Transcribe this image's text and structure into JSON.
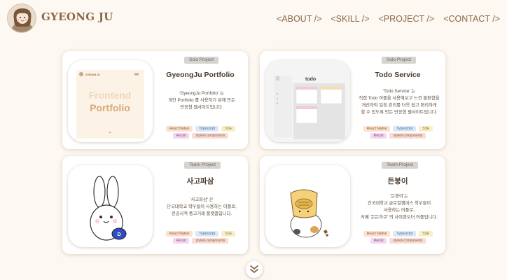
{
  "header": {
    "brand": "GYEONG JU",
    "nav": [
      "<ABOUT />",
      "<SKILL />",
      "<PROJECT />",
      "<CONTACT />"
    ]
  },
  "colors": {
    "accent": "#8a6a4a",
    "background": "#fdf8f1"
  },
  "projects": [
    {
      "type": "Solo Project",
      "title": "GyeongJu Portfolio",
      "desc": "'GyeongJu Portfolio' 는\n개인 Portfolio 를 사용하기 위해 만든\n반응형 웹사이트입니다.",
      "thumb": {
        "brand": "GYEONG JU",
        "line1": "Frontend",
        "line2": "Portfolio"
      },
      "chips": [
        "React Native",
        "Typescript",
        "SSE",
        "Recoil",
        "styled-components"
      ]
    },
    {
      "type": "Solo Project",
      "title": "Todo Service",
      "desc": "'Todo Service' 는\n직접 Todo 어플을 사용해보고 느낀 불편함을\n개선하여 일정 관리를 더욱 쉽고 편리하게\n할 수 있도록 만든 반응형 웹사이트입니다.",
      "thumb": {
        "app_title": "todo"
      },
      "chips": [
        "React Native",
        "Typescript",
        "SSE",
        "Recoil",
        "styled-components"
      ]
    },
    {
      "type": "Team Project",
      "title": "사고파삼",
      "desc": "'사고파삼' 은\n단국대학교 학우들이 사용하는 어플로,\n전공서적 중고거래 플랫폼입니다.",
      "chips": [
        "React Native",
        "Typescript",
        "SSE",
        "Recoil",
        "styled-components"
      ]
    },
    {
      "type": "Team Project",
      "title": "든붕이",
      "desc": "'든붕이'는\n건국대학교 글로컬캠퍼스 학우들이\n사용하는 어플로,\n카페 '든든하쿠' 의 사이렌오더 어플입니다.",
      "chips": [
        "React Native",
        "Typescript",
        "SSE",
        "Recoil",
        "styled-components"
      ]
    }
  ],
  "icons": {
    "scroll": "double-chevron-down-icon"
  }
}
